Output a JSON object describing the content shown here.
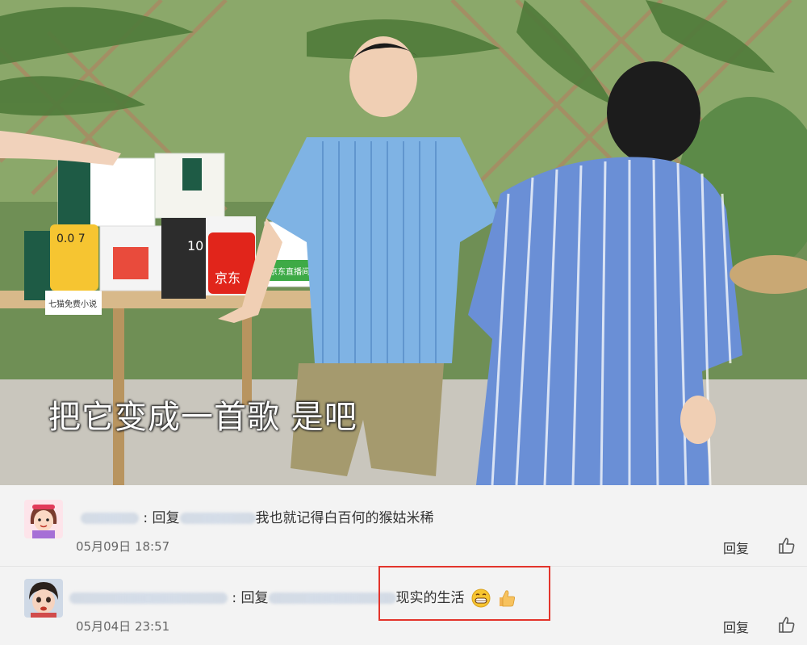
{
  "video": {
    "subtitle": "把它变成一首歌 是吧",
    "scene_objects": {
      "box_logo_left": "0.0 7",
      "box_logo_left_caption": "七猫免费小说",
      "box_logo_number": "10",
      "box_logo_jd": "京东",
      "box_logo_right": "京东直播间"
    }
  },
  "comments": [
    {
      "reply_prefix": "回复",
      "separator": ":",
      "text": "我也就记得白百何的猴姑米稀",
      "timestamp": "05月09日 18:57",
      "reply_button": "回复"
    },
    {
      "reply_prefix": "回复",
      "separator": ":",
      "text": "现实的生活",
      "emojis": [
        "grin-emoji",
        "thumbs-up-emoji"
      ],
      "timestamp": "05月04日 23:51",
      "reply_button": "回复"
    }
  ],
  "colors": {
    "highlight_border": "#e3342b",
    "background": "#f3f3f3"
  }
}
